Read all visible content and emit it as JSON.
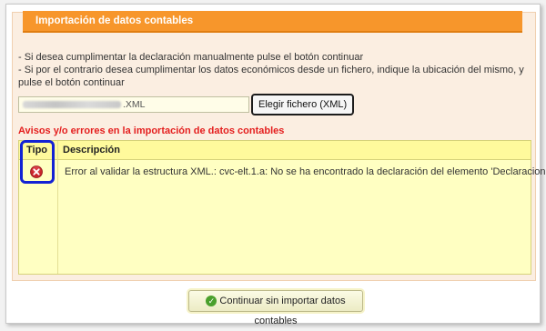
{
  "panel": {
    "title": "Importación de datos contables"
  },
  "instructions": {
    "line1": "- Si desea cumplimentar la declaración manualmente pulse el botón continuar",
    "line2": "- Si por el contrario desea cumplimentar los datos económicos desde un fichero, indique la ubicación del mismo, y pulse el botón continuar"
  },
  "file": {
    "value_suffix": ".XML",
    "choose_button": "Elegir fichero (XML)"
  },
  "warnings": {
    "title": "Avisos y/o errores en la importación de datos contables",
    "columns": {
      "tipo": "Tipo",
      "descripcion": "Descripción"
    },
    "rows": [
      {
        "icon": "error-icon",
        "message": "Error al validar la estructura XML.: cvc-elt.1.a: No se ha encontrado la declaración del elemento 'Declaracion'."
      }
    ]
  },
  "footer": {
    "continue_button": "Continuar sin importar datos contables"
  },
  "colors": {
    "header": "#f7962b",
    "warning_text": "#e41e1e",
    "highlight": "#1322d4",
    "table_bg": "#ffffc2"
  }
}
